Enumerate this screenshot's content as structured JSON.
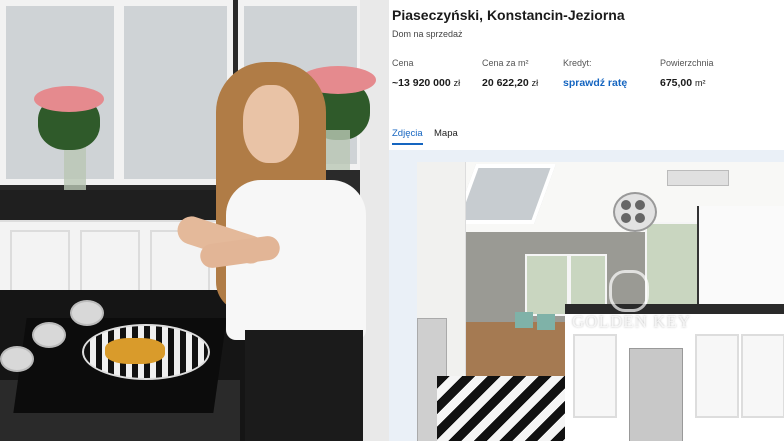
{
  "listing": {
    "title": "Piaseczyński, Konstancin-Jeziorna",
    "subtitle": "Dom na sprzedaż",
    "facts": [
      {
        "label": "Cena",
        "value": "~13 920 000",
        "unit": "zł"
      },
      {
        "label": "Cena za m²",
        "value": "20 622,20",
        "unit": "zł"
      },
      {
        "label": "Kredyt:",
        "value": "sprawdź ratę",
        "unit": ""
      },
      {
        "label": "Powierzchnia",
        "value": "675,00",
        "unit": "m²"
      }
    ],
    "tabs": [
      {
        "label": "Zdjęcia",
        "active": true
      },
      {
        "label": "Mapa",
        "active": false
      }
    ],
    "accent_color": "#1565c0",
    "gallery_bg_color": "#eaf0f7"
  },
  "photo": {
    "watermark": "GOLDEN KEY"
  }
}
